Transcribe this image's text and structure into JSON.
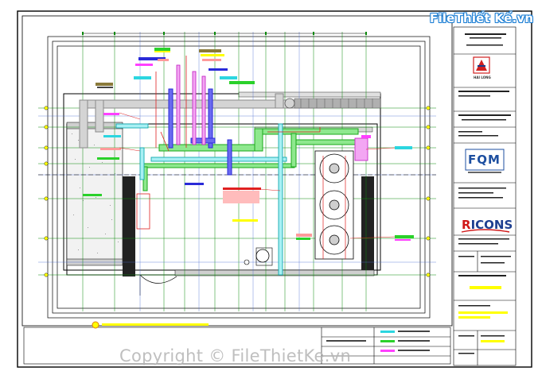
{
  "watermark": {
    "brand_prefix": "File",
    "brand_suffix": "Thiết Kế.vn",
    "copyright": "Copyright © FileThietKe.vn"
  },
  "title_block": {
    "logo_1": "HAI LONG",
    "logo_2": "FQM",
    "logo_3_r": "R",
    "logo_3_rest": "ICONS"
  },
  "colors": {
    "frame": "#000000",
    "pipe_gray": "#a8a8a8",
    "pipe_green": "#2fd12f",
    "pipe_blue": "#2a2ad8",
    "pipe_cyan": "#2bd6e0",
    "pipe_magenta": "#d81fd8",
    "pipe_red": "#e02020",
    "highlight_yellow": "#ffff00",
    "highlight_green": "#2ad12a",
    "highlight_magenta": "#ff40ff",
    "tag_olive": "#8a7a3a",
    "tag_salmon": "#ff9a9a"
  }
}
